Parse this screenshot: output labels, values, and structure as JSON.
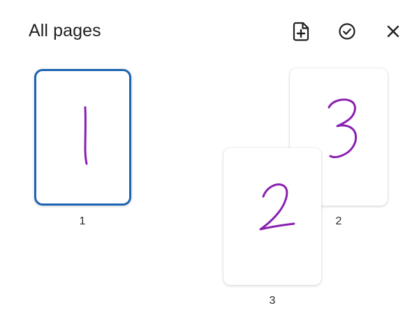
{
  "header": {
    "title": "All pages",
    "actions": [
      {
        "name": "add-page",
        "icon": "add-page-icon"
      },
      {
        "name": "select",
        "icon": "check-circle-icon"
      },
      {
        "name": "close",
        "icon": "close-icon"
      }
    ]
  },
  "pages": [
    {
      "label": "1",
      "ink": "1",
      "selected": true
    },
    {
      "label": "2",
      "ink": "3",
      "selected": false
    },
    {
      "label": "3",
      "ink": "2",
      "selected": false
    }
  ],
  "colors": {
    "selection_border": "#1b63b3",
    "ink": "#8a1fb0",
    "text": "#1f1f1f"
  }
}
